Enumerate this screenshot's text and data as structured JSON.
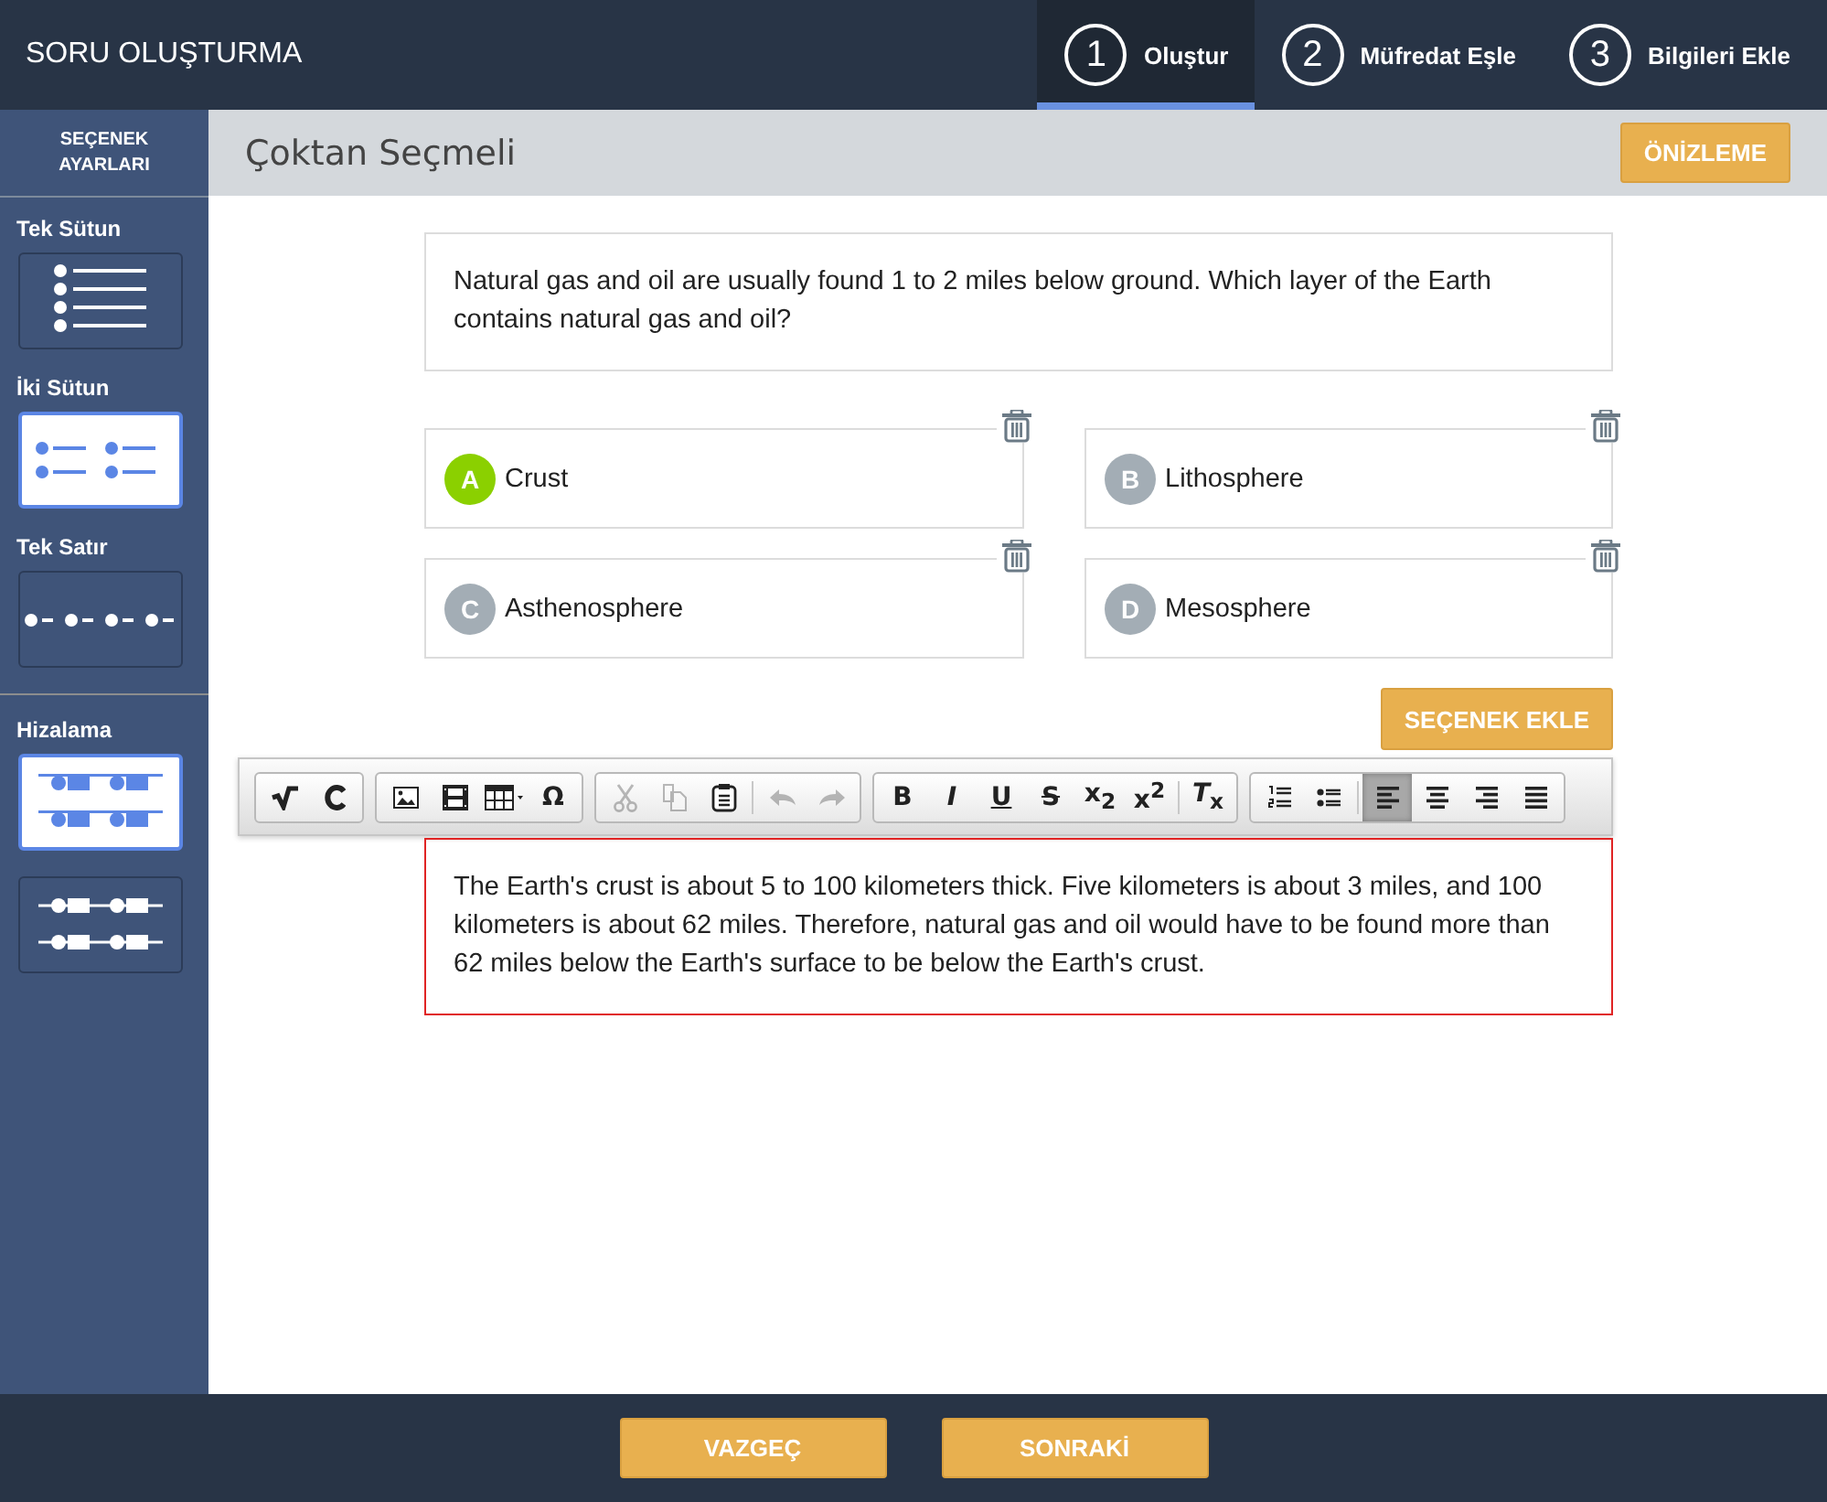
{
  "header": {
    "title": "SORU OLUŞTURMA"
  },
  "steps": [
    {
      "number": "1",
      "label": "Oluştur",
      "selected": true
    },
    {
      "number": "2",
      "label": "Müfredat Eşle",
      "selected": false
    },
    {
      "number": "3",
      "label": "Bilgileri Ekle",
      "selected": false
    }
  ],
  "sidebar": {
    "heading": "SEÇENEK AYARLARI",
    "layouts": [
      {
        "label": "Tek Sütun",
        "kind": "single-column",
        "selected": false
      },
      {
        "label": "İki Sütun",
        "kind": "two-column",
        "selected": true
      },
      {
        "label": "Tek Satır",
        "kind": "single-row",
        "selected": false
      }
    ],
    "alignment": {
      "label": "Hizalama",
      "options": [
        {
          "kind": "top",
          "selected": true
        },
        {
          "kind": "middle",
          "selected": false
        }
      ]
    }
  },
  "page_title": "Çoktan Seçmeli",
  "preview_button": "ÖNİZLEME",
  "question": "Natural gas and oil are usually found 1 to 2 miles below ground. Which layer of the Earth contains natural gas and oil?",
  "choices": [
    {
      "letter": "A",
      "text": "Crust",
      "correct": true
    },
    {
      "letter": "B",
      "text": "Lithosphere",
      "correct": false
    },
    {
      "letter": "C",
      "text": "Asthenosphere",
      "correct": false
    },
    {
      "letter": "D",
      "text": "Mesosphere",
      "correct": false
    }
  ],
  "add_choice_button": "SEÇENEK EKLE",
  "toolbar": [
    {
      "buttons": [
        {
          "kind": "sqrt",
          "disabled": false,
          "selected": false
        },
        {
          "kind": "c",
          "disabled": false,
          "selected": false
        }
      ]
    },
    {
      "buttons": [
        {
          "kind": "image",
          "disabled": false,
          "selected": false
        },
        {
          "kind": "film",
          "disabled": false,
          "selected": false
        },
        {
          "kind": "table",
          "disabled": false,
          "selected": false
        },
        {
          "kind": "char",
          "label": "Ω",
          "disabled": false,
          "selected": false
        }
      ]
    },
    {
      "buttons": [
        {
          "kind": "cut",
          "disabled": true,
          "selected": false
        },
        {
          "kind": "copy",
          "disabled": true,
          "selected": false
        },
        {
          "kind": "paste",
          "disabled": false,
          "selected": false
        },
        {
          "kind": "separator"
        },
        {
          "kind": "undo",
          "disabled": true,
          "selected": false
        },
        {
          "kind": "redo",
          "disabled": true,
          "selected": false
        }
      ]
    },
    {
      "buttons": [
        {
          "kind": "char",
          "label": "B",
          "disabled": false,
          "selected": false
        },
        {
          "kind": "char",
          "label": "*I*",
          "disabled": false,
          "selected": false
        },
        {
          "kind": "underline",
          "label": "U",
          "disabled": false,
          "selected": false
        },
        {
          "kind": "strike",
          "label": "S",
          "disabled": false,
          "selected": false
        },
        {
          "kind": "char",
          "label": "x$_{2}$",
          "disabled": false,
          "selected": false
        },
        {
          "kind": "char",
          "label": "x$^{2}$",
          "disabled": false,
          "selected": false
        },
        {
          "kind": "separator"
        },
        {
          "kind": "char",
          "label": "*T*$_{x}$",
          "disabled": false,
          "selected": false
        }
      ]
    },
    {
      "buttons": [
        {
          "kind": "ordered-list",
          "disabled": false,
          "selected": false
        },
        {
          "kind": "bullet-list",
          "disabled": false,
          "selected": false
        },
        {
          "kind": "separator"
        },
        {
          "kind": "align-left",
          "disabled": false,
          "selected": true
        },
        {
          "kind": "align-center",
          "disabled": false,
          "selected": false
        },
        {
          "kind": "align-right",
          "disabled": false,
          "selected": false
        },
        {
          "kind": "justify",
          "disabled": false,
          "selected": false
        }
      ]
    }
  ],
  "explanation": "The Earth's crust is about 5 to 100 kilometers thick. Five kilometers is about 3 miles, and 100 kilometers is about 62 miles. Therefore, natural gas and oil would have to be found more than 62 miles below the Earth's surface to be below the Earth's crust.",
  "footer_buttons": [
    "VAZGEÇ",
    "SONRAKİ"
  ]
}
